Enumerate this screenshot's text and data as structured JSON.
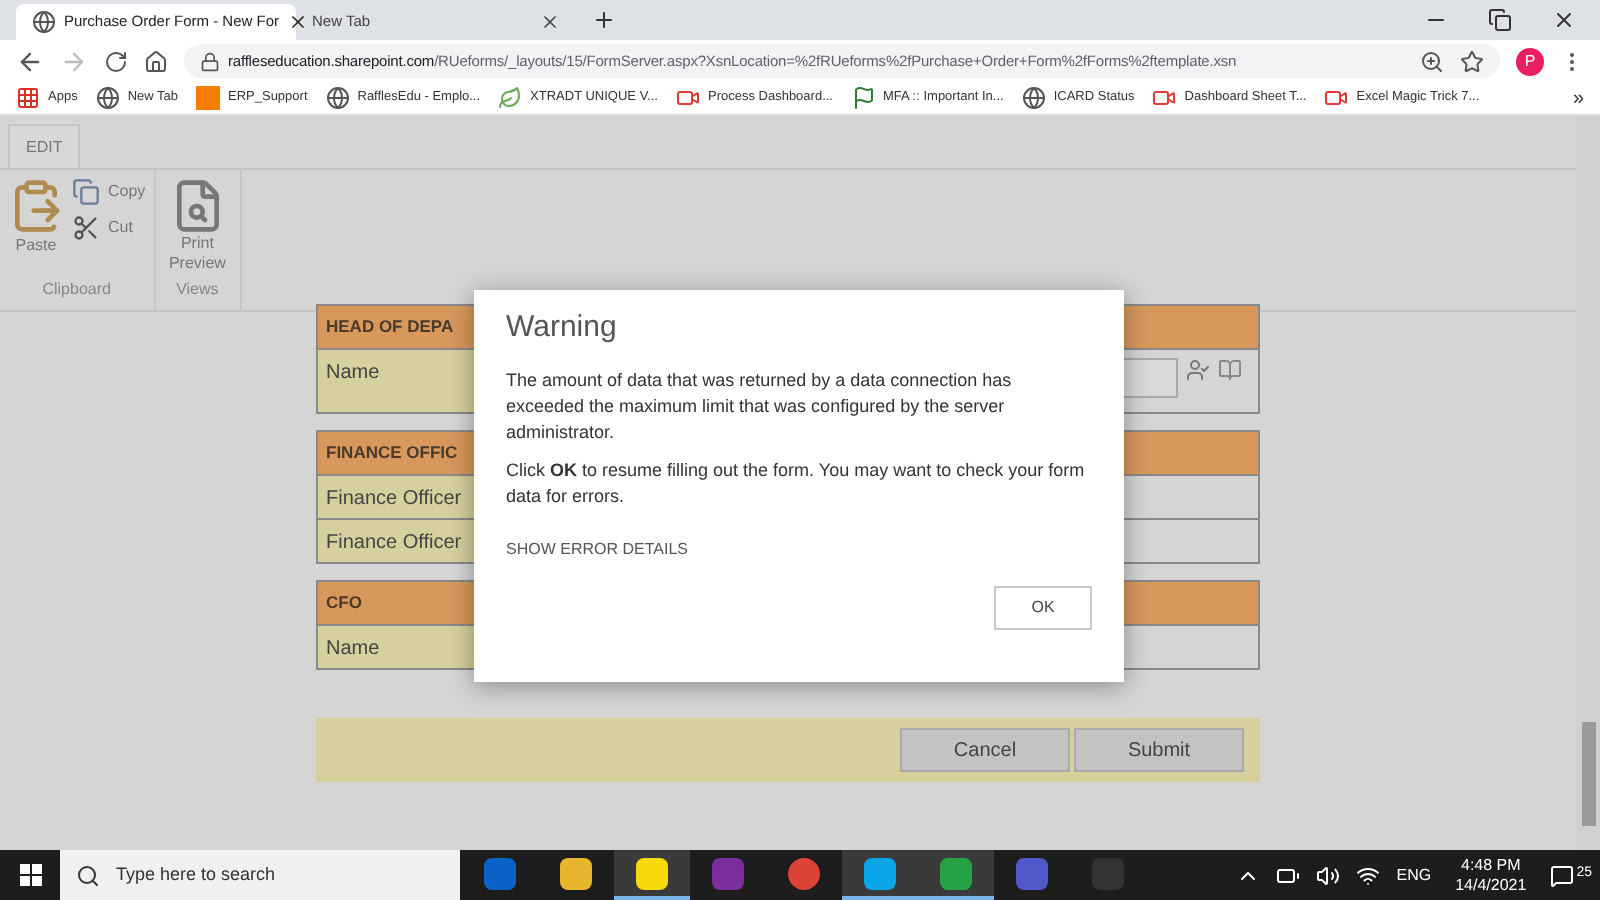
{
  "browser": {
    "tabs": [
      {
        "label": "Purchase Order Form - New For",
        "selected": true
      },
      {
        "label": "New Tab",
        "selected": false
      }
    ],
    "url": {
      "host": "raffleseducation.sharepoint.com",
      "path": "/RUeforms/_layouts/15/FormServer.aspx?XsnLocation=%2fRUeforms%2fPurchase+Order+Form%2fForms%2ftemplate.xsn"
    },
    "profile_initial": "P",
    "bookmarks": [
      {
        "label": "Apps",
        "kind": "apps"
      },
      {
        "label": "New Tab",
        "kind": "globe"
      },
      {
        "label": "ERP_Support",
        "kind": "orange"
      },
      {
        "label": "RafflesEdu - Emplo...",
        "kind": "globe"
      },
      {
        "label": "XTRADT UNIQUE V...",
        "kind": "leaf"
      },
      {
        "label": "Process Dashboard...",
        "kind": "video"
      },
      {
        "label": "MFA :: Important In...",
        "kind": "flag"
      },
      {
        "label": "ICARD Status",
        "kind": "globe"
      },
      {
        "label": "Dashboard Sheet T...",
        "kind": "video"
      },
      {
        "label": "Excel Magic Trick 7...",
        "kind": "video"
      }
    ],
    "more": "»"
  },
  "ribbon": {
    "tabs": [
      {
        "label": "EDIT",
        "selected": true
      }
    ],
    "groups": [
      {
        "label": "Clipboard",
        "items": [
          {
            "label": "Paste",
            "kind": "paste"
          },
          {
            "label": "Copy",
            "kind": "copy"
          },
          {
            "label": "Cut",
            "kind": "cut"
          }
        ]
      },
      {
        "label": "Views",
        "items": [
          {
            "label": "Print Preview",
            "kind": "preview"
          }
        ]
      }
    ]
  },
  "form": {
    "sections": [
      {
        "title": "HEAD OF DEPA",
        "rows": [
          {
            "label": "Name",
            "kind": "people"
          }
        ]
      },
      {
        "title": "FINANCE OFFIC",
        "rows": [
          {
            "label": "Finance Officer",
            "kind": "text"
          },
          {
            "label": "Finance Officer",
            "kind": "text"
          }
        ]
      },
      {
        "title": "CFO",
        "rows": [
          {
            "label": "Name",
            "kind": "text"
          }
        ]
      }
    ],
    "buttons": [
      "Cancel",
      "Submit"
    ]
  },
  "dialog": {
    "title": "Warning",
    "paragraphs": [
      "The amount of data that was returned by a data connection has exceeded the maximum limit that was configured by the server administrator.",
      "Click **OK** to resume filling out the form. You may want to check your form data for errors."
    ],
    "details_link": "SHOW ERROR DETAILS",
    "ok": "OK"
  },
  "taskbar": {
    "search_placeholder": "Type here to search",
    "apps": [
      {
        "kind": "outlook",
        "color": "#0a64c8",
        "active": false
      },
      {
        "kind": "files",
        "color": "#e8b62c",
        "active": false
      },
      {
        "kind": "notes",
        "color": "#f5d90a",
        "active": true
      },
      {
        "kind": "app",
        "color": "#7a2f9a",
        "active": false
      },
      {
        "kind": "chrome",
        "color": "#db4437",
        "active": false
      },
      {
        "kind": "skype",
        "color": "#0aa4e8",
        "active": true
      },
      {
        "kind": "whatsapp",
        "color": "#25a244",
        "active": true
      },
      {
        "kind": "teams",
        "color": "#5059c9",
        "active": false
      },
      {
        "kind": "window",
        "color": "#333333",
        "active": false
      }
    ],
    "lang": "ENG",
    "time": "4:48 PM",
    "date": "14/4/2021",
    "notifications": "25"
  }
}
